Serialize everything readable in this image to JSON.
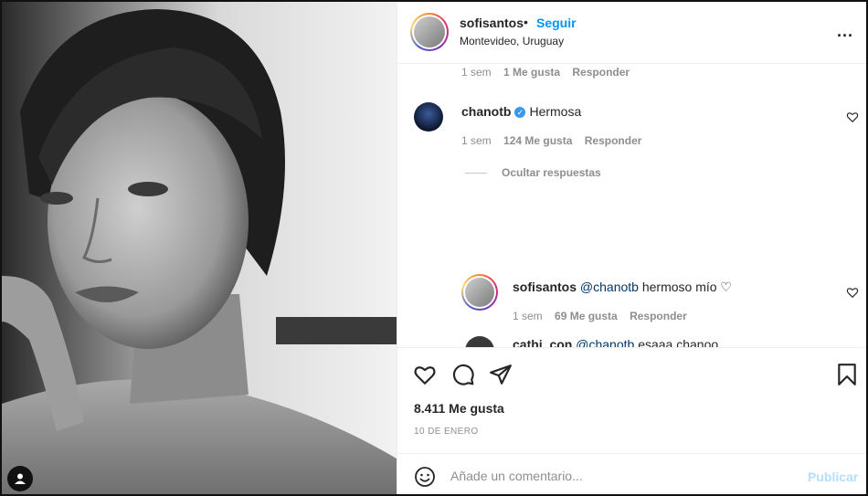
{
  "header": {
    "username": "sofisantos",
    "separator": "•",
    "follow_label": "Seguir",
    "location": "Montevideo, Uruguay",
    "more_label": "..."
  },
  "comments": {
    "prev_meta": {
      "time": "1 sem",
      "likes": "1 Me gusta",
      "reply": "Responder"
    },
    "items": [
      {
        "username": "chanotb",
        "verified": true,
        "verified_glyph": "✓",
        "text": "Hermosa",
        "time": "1 sem",
        "likes": "124 Me gusta",
        "reply": "Responder",
        "hide_replies": "Ocultar respuestas"
      }
    ],
    "replies": [
      {
        "username": "sofisantos",
        "mention": "@chanotb",
        "text": "hermoso mío ♡",
        "time": "1 sem",
        "likes": "69 Me gusta",
        "reply": "Responder"
      },
      {
        "username": "cathi_con",
        "mention": "@chanotb",
        "text": "esaaa chanoo"
      }
    ]
  },
  "actions": {
    "icons": [
      "heart-icon",
      "comment-icon",
      "share-icon",
      "bookmark-icon"
    ],
    "likes_text": "8.411 Me gusta",
    "date": "10 DE ENERO"
  },
  "composer": {
    "placeholder": "Añade un comentario...",
    "publish_label": "Publicar"
  },
  "colors": {
    "follow": "#0095f6",
    "publish_disabled": "#b2dffc",
    "verified": "#3897f0"
  }
}
